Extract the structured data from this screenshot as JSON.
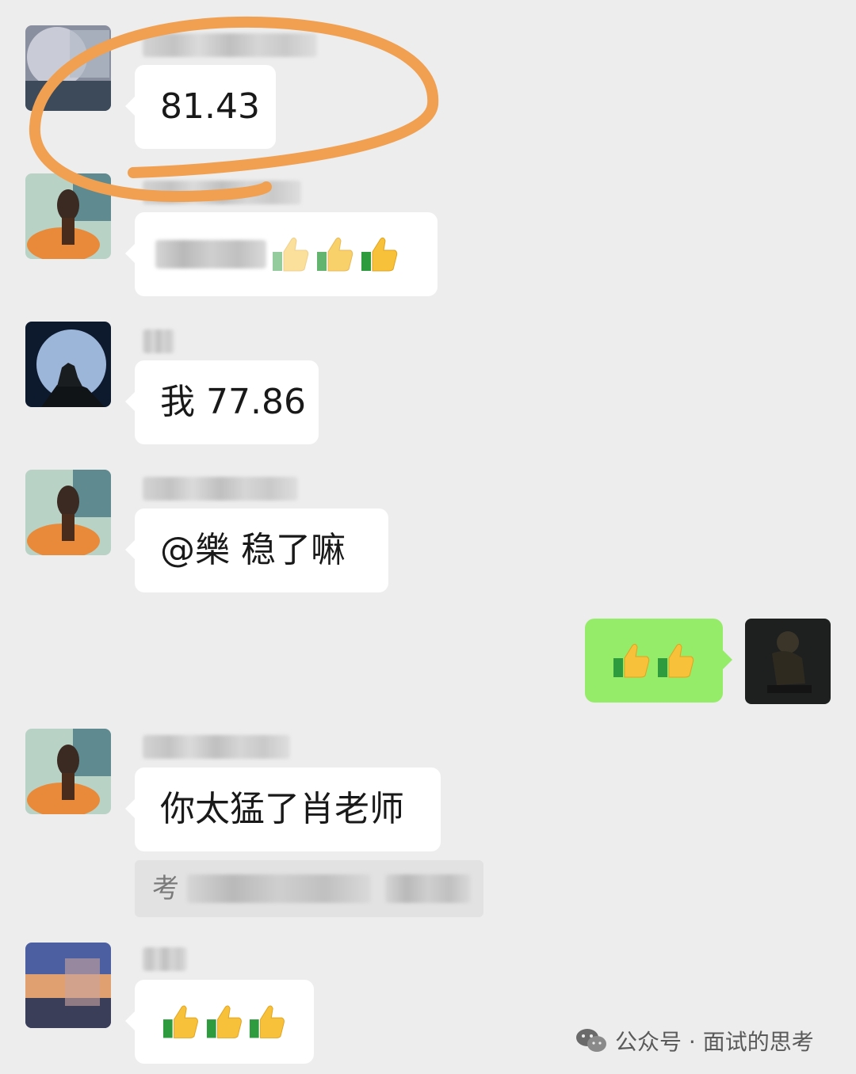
{
  "messages": [
    {
      "id": "m1",
      "side": "left",
      "text": "81.43"
    },
    {
      "id": "m2",
      "side": "left",
      "emoji": "thumbs-up",
      "count": 3
    },
    {
      "id": "m3",
      "side": "left",
      "text": "我 77.86"
    },
    {
      "id": "m4",
      "side": "left",
      "text": "@樂  稳了嘛"
    },
    {
      "id": "m5",
      "side": "right",
      "emoji": "thumbs-up",
      "count": 2
    },
    {
      "id": "m6",
      "side": "left",
      "text": "你太猛了肖老师"
    },
    {
      "id": "m7",
      "side": "left",
      "emoji": "thumbs-up",
      "count": 3
    }
  ],
  "quote": {
    "prefix": "考"
  },
  "watermark": {
    "text": "公众号 · 面试的思考"
  },
  "colors": {
    "background": "#ededed",
    "bubble_in": "#ffffff",
    "bubble_out": "#95ec69",
    "annotation_circle": "#f0a050"
  }
}
